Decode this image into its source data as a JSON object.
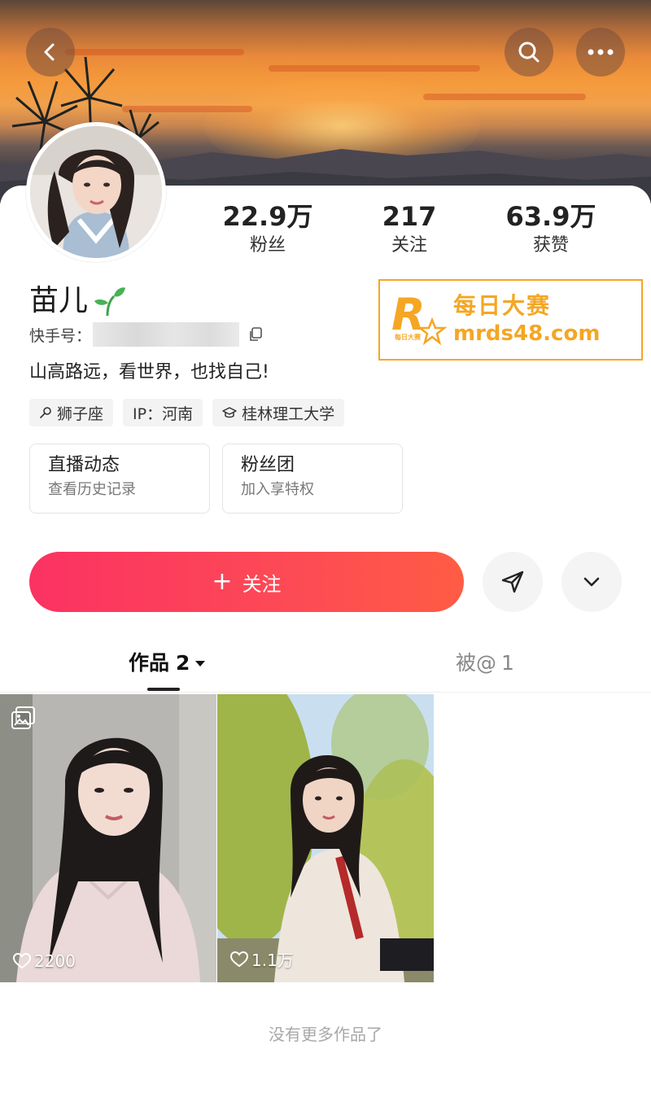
{
  "header": {
    "back_icon": "chevron-left-icon",
    "search_icon": "search-icon",
    "more_icon": "more-icon"
  },
  "stats": {
    "fans": {
      "value": "22.9万",
      "label": "粉丝"
    },
    "following": {
      "value": "217",
      "label": "关注"
    },
    "likes": {
      "value": "63.9万",
      "label": "获赞"
    }
  },
  "profile": {
    "name": "苗儿",
    "kuaishou_id_label": "快手号：",
    "bio": "山高路远，看世界，也找自己!",
    "tags": [
      "狮子座",
      "IP：河南",
      "桂林理工大学"
    ]
  },
  "features": [
    {
      "title": "直播动态",
      "subtitle": "查看历史记录"
    },
    {
      "title": "粉丝团",
      "subtitle": "加入享特权"
    }
  ],
  "actions": {
    "follow_label": "关注",
    "follow_plus": "+",
    "share_icon": "send-icon",
    "more_icon": "chevron-down-icon"
  },
  "tabs": {
    "works_label": "作品",
    "works_count": "2",
    "mentioned_label": "被@",
    "mentioned_count": "1"
  },
  "posts": [
    {
      "likes": "2200",
      "type": "gallery"
    },
    {
      "likes": "1.1万",
      "type": "video"
    }
  ],
  "footer": {
    "no_more": "没有更多作品了"
  },
  "watermark": {
    "cn": "每日大赛",
    "en": "mrds48.com",
    "logo_letter": "R",
    "logo_small": "每日大赛"
  },
  "colors": {
    "accent": "#fd3a5c",
    "watermark": "#f5a623"
  }
}
